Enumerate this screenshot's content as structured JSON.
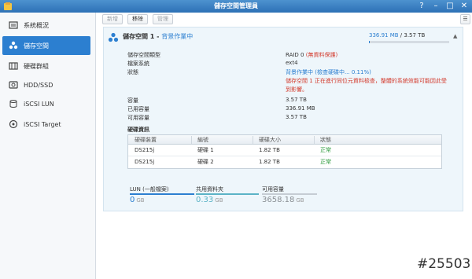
{
  "window": {
    "title": "儲存空間管理員"
  },
  "sidebar": {
    "items": [
      {
        "label": "系統概況",
        "icon": "overview-icon"
      },
      {
        "label": "儲存空間",
        "icon": "volume-icon",
        "active": true
      },
      {
        "label": "硬碟群組",
        "icon": "disk-group-icon"
      },
      {
        "label": "HDD/SSD",
        "icon": "hdd-icon"
      },
      {
        "label": "iSCSI LUN",
        "icon": "iscsi-lun-icon"
      },
      {
        "label": "iSCSI Target",
        "icon": "iscsi-target-icon"
      }
    ]
  },
  "toolbar": {
    "new": "新增",
    "remove": "移除",
    "manage": "管理"
  },
  "volume": {
    "name": "儲存空間 1 - ",
    "status": "背景作業中",
    "used": "336.91 MB",
    "total": " / 3.57 TB",
    "usage_fraction": 0.0001,
    "colors": {
      "accent": "#2c7fd0",
      "warning": "#d33a2c",
      "healthy": "#2a9a3a"
    }
  },
  "details": {
    "raid_label": "儲存空間類型",
    "raid_value": "RAID 0",
    "raid_note": "(無資料保護)",
    "fs_label": "檔案系統",
    "fs_value": "ext4",
    "status_label": "狀態",
    "status_value": "背景作業中 (檢查硬碟中... 0.11%)",
    "warning": "儲存空間 1 正在進行同位元資料檢查，整體的系統效能可能因此受到影響。",
    "capacity_label": "容量",
    "capacity_value": "3.57 TB",
    "used_label": "已用容量",
    "used_value": "336.91 MB",
    "avail_label": "可用容量",
    "avail_value": "3.57 TB"
  },
  "disks": {
    "title": "硬碟資訊",
    "headers": [
      "硬碟裝置",
      "編號",
      "硬碟大小",
      "狀態"
    ],
    "rows": [
      {
        "device": "DS215j",
        "slot": "硬碟 1",
        "size": "1.82 TB",
        "status": "正常"
      },
      {
        "device": "DS215j",
        "slot": "硬碟 2",
        "size": "1.82 TB",
        "status": "正常"
      }
    ]
  },
  "stats": {
    "lun_label": "LUN (一般檔案)",
    "lun_value": "0",
    "lun_unit": "GB",
    "share_label": "共用資料夾",
    "share_value": "0.33",
    "share_unit": "GB",
    "free_label": "可用容量",
    "free_value": "3658.18",
    "free_unit": "GB"
  },
  "watermark": "#25503"
}
